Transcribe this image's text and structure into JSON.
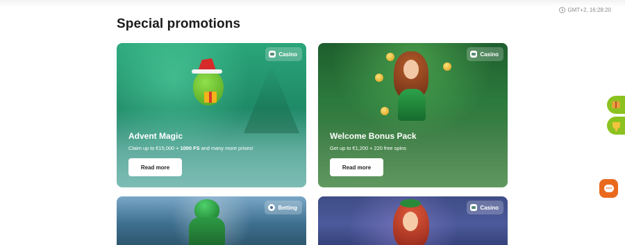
{
  "header": {
    "clock_text": "GMT+2, 16:28:20"
  },
  "page": {
    "title": "Special promotions"
  },
  "promotions": [
    {
      "badge": "Casino",
      "title": "Advent Magic",
      "subtitle_prefix": "Claim up to €15,000 + ",
      "subtitle_bold": "1000 FS",
      "subtitle_suffix": " and many more prises!",
      "button": "Read more"
    },
    {
      "badge": "Casino",
      "title": "Welcome Bonus Pack",
      "subtitle": "Get up to €1,200 + 220 free spins",
      "button": "Read more"
    },
    {
      "badge": "Betting"
    },
    {
      "badge": "Casino"
    }
  ],
  "colors": {
    "side_widget": "#8cc21f",
    "chat_button": "#ea6a1d"
  },
  "icons": {
    "clock": "clock-icon",
    "side_1": "gift-icon",
    "side_2": "trophy-icon",
    "chat": "chat-icon"
  }
}
